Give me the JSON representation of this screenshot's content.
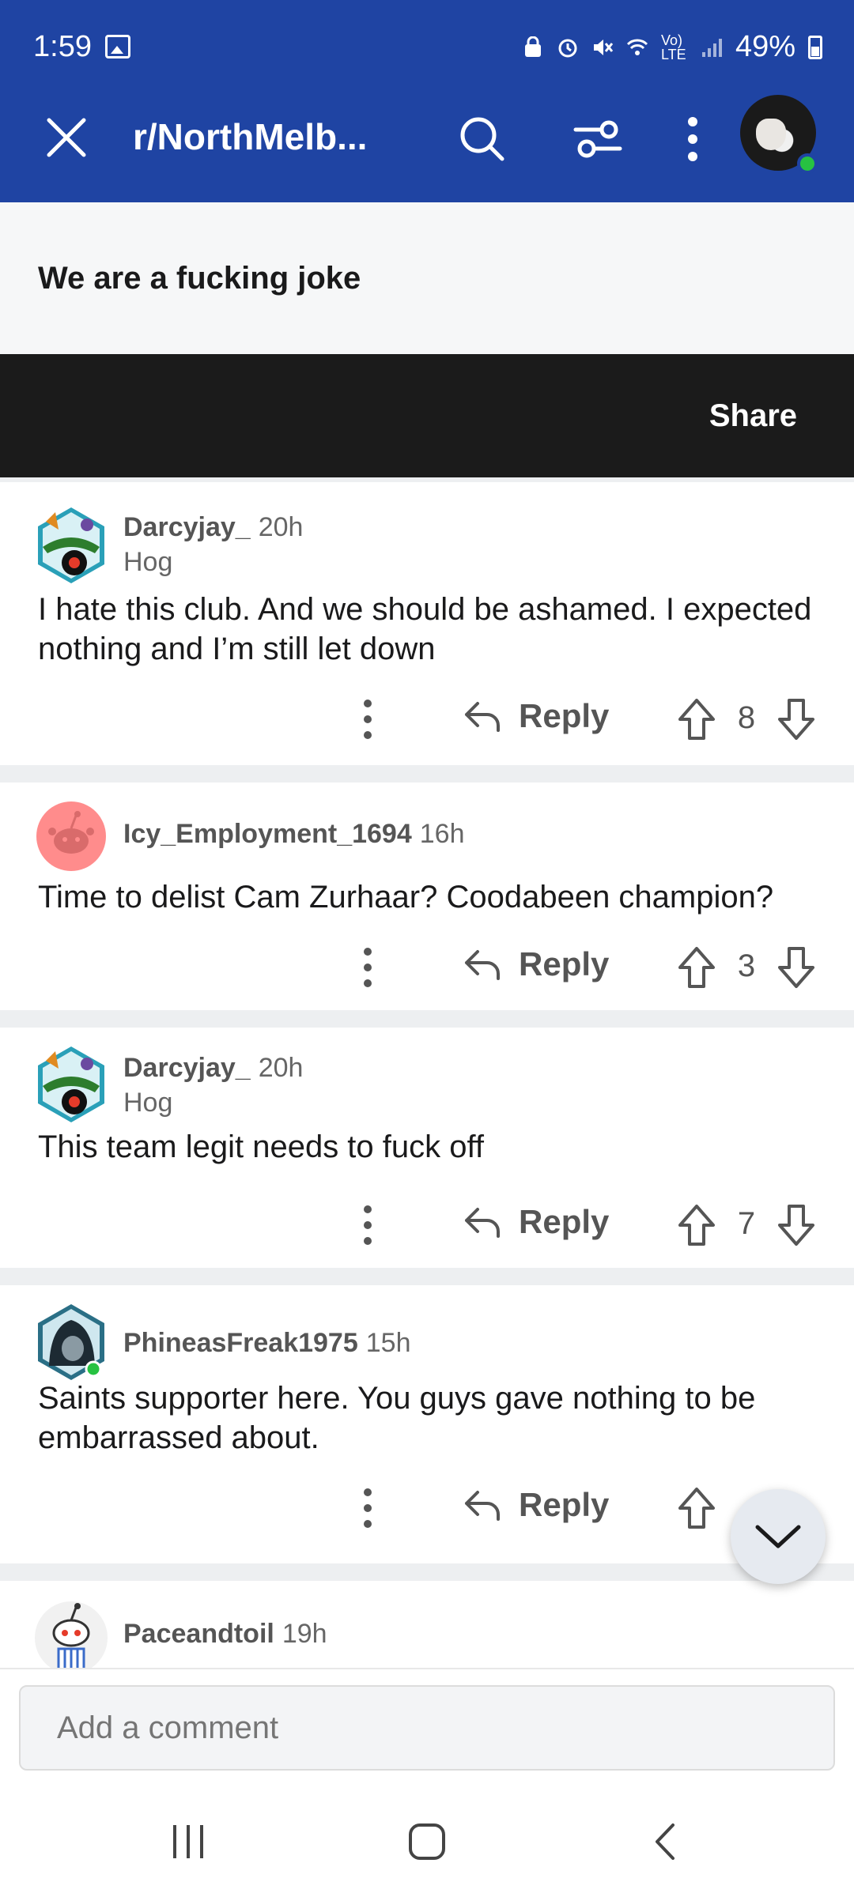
{
  "status_bar": {
    "time": "1:59",
    "battery": "49%",
    "network": "Vo) LTE"
  },
  "app_bar": {
    "title": "r/NorthMelb..."
  },
  "post": {
    "title": "We are a fucking joke",
    "share_label": "Share"
  },
  "comments": [
    {
      "user": "Darcyjay_",
      "time": "20h",
      "flair": "Hog",
      "body": "I hate this club. And we should be ashamed. I expected nothing and I’m still let down",
      "reply_label": "Reply",
      "score": "8"
    },
    {
      "user": "Icy_Employment_1694",
      "time": "16h",
      "flair": "",
      "body": "Time to delist Cam Zurhaar? Coodabeen champion?",
      "reply_label": "Reply",
      "score": "3"
    },
    {
      "user": "Darcyjay_",
      "time": "20h",
      "flair": "Hog",
      "body": "This team legit needs to fuck off",
      "reply_label": "Reply",
      "score": "7"
    },
    {
      "user": "PhineasFreak1975",
      "time": "15h",
      "flair": "",
      "body": "Saints supporter here. You guys gave nothing to be embarrassed about.",
      "reply_label": "Reply",
      "score": ""
    },
    {
      "user": "Paceandtoil",
      "time": "19h",
      "flair": "",
      "body": "",
      "reply_label": "",
      "score": ""
    }
  ],
  "composer": {
    "placeholder": "Add a comment"
  },
  "colors": {
    "header_blue": "#1f44a3",
    "share_bar": "#1b1b1b",
    "online_green": "#27c242"
  },
  "icons": [
    "close-icon",
    "search-icon",
    "filter-icon",
    "more-vertical-icon",
    "reply-icon",
    "upvote-icon",
    "downvote-icon",
    "chevron-down-icon"
  ]
}
